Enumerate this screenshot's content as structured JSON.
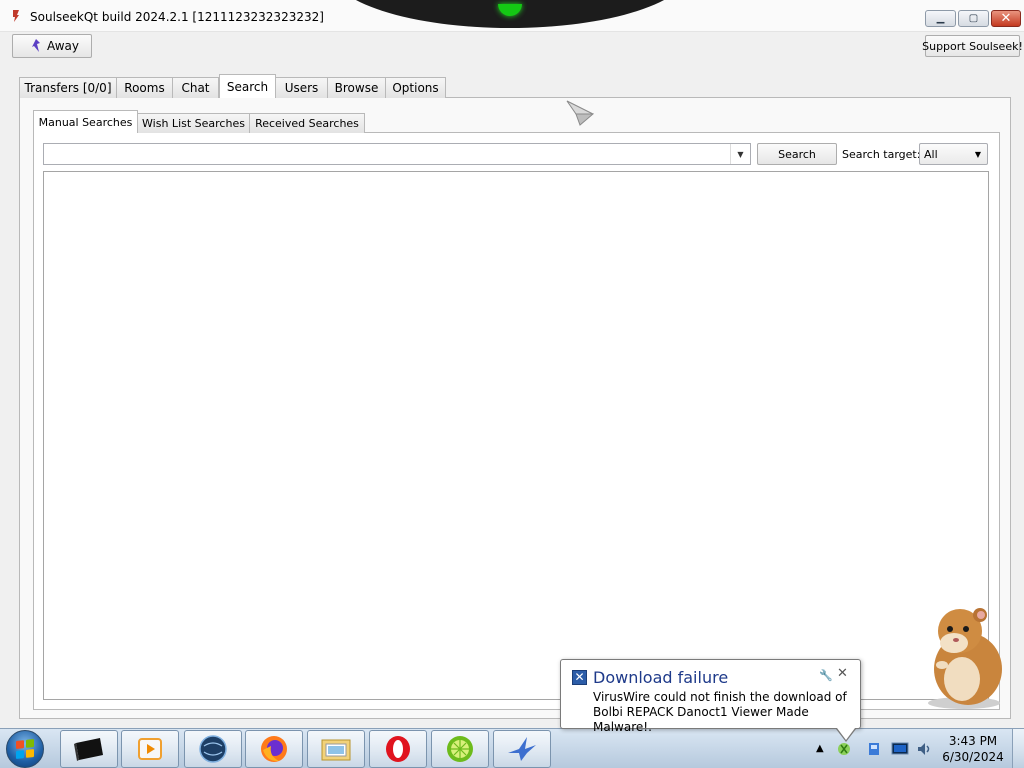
{
  "window": {
    "title": "SoulseekQt build 2024.2.1 [1211123232323232]",
    "controls": {
      "minimize": "▁",
      "maximize": "▢",
      "close": "✕"
    }
  },
  "toolbar": {
    "away_label": "Away",
    "support_label": "Support Soulseek!"
  },
  "main_tabs": [
    {
      "label": "Transfers [0/0]"
    },
    {
      "label": "Rooms"
    },
    {
      "label": "Chat"
    },
    {
      "label": "Search"
    },
    {
      "label": "Users"
    },
    {
      "label": "Browse"
    },
    {
      "label": "Options"
    }
  ],
  "main_active_tab": "Search",
  "sub_tabs": [
    {
      "label": "Manual Searches"
    },
    {
      "label": "Wish List Searches"
    },
    {
      "label": "Received Searches"
    }
  ],
  "search": {
    "query_value": "",
    "button_label": "Search",
    "target_label": "Search target:",
    "target_value": "All"
  },
  "notification": {
    "title": "Download failure",
    "body": "VirusWire could not finish the download of Bolbi REPACK Danoct1 Viewer Made Malware!."
  },
  "taskbar": {
    "apps": [
      "terminal-app",
      "media-player-app",
      "globe-app",
      "firefox-app",
      "file-manager-app",
      "opera-app",
      "lime-app",
      "bird-app"
    ]
  },
  "clock": {
    "time": "3:43 PM",
    "date": "6/30/2024"
  },
  "colors": {
    "window_bg": "#f0f0f0",
    "close_button": "#c3391f",
    "notification_title": "#1e3a8a",
    "taskbar": "#c8d8ea"
  }
}
